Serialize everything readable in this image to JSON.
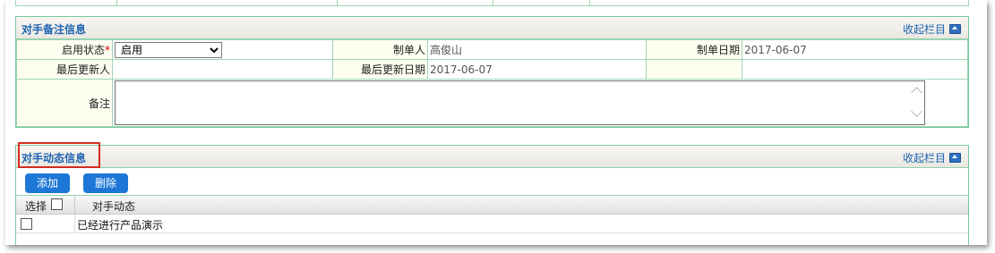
{
  "remarks_section": {
    "title": "对手备注信息",
    "collapse_label": "收起栏目",
    "enable_status_label": "启用状态",
    "required_mark": "*",
    "enable_status_value": "启用",
    "creator_label": "制单人",
    "creator_value": "高俊山",
    "create_date_label": "制单日期",
    "create_date_value": "2017-06-07",
    "last_updater_label": "最后更新人",
    "last_updater_value": "",
    "last_update_date_label": "最后更新日期",
    "last_update_date_value": "2017-06-07",
    "notes_label": "备注",
    "notes_value": ""
  },
  "dynamics_section": {
    "title": "对手动态信息",
    "collapse_label": "收起栏目",
    "add_label": "添加",
    "delete_label": "删除",
    "columns": {
      "select": "选择",
      "dynamic": "对手动态"
    },
    "rows": [
      {
        "dynamic": "已经进行产品演示",
        "selected": false
      }
    ]
  },
  "colors": {
    "accent": "#1e63b2",
    "button": "#1d77d6",
    "border": "#77c89b",
    "highlight": "#d62b22"
  }
}
